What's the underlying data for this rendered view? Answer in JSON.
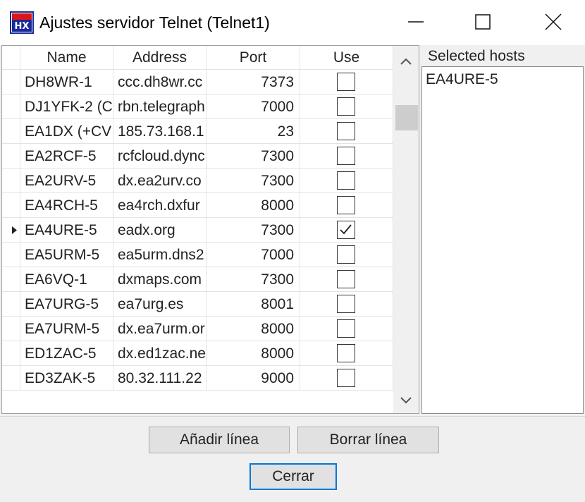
{
  "window": {
    "title": "Ajustes servidor Telnet (Telnet1)",
    "icon": "hx-app-icon",
    "controls": [
      "minimize-icon",
      "maximize-icon",
      "close-icon"
    ]
  },
  "grid": {
    "columns": [
      "Name",
      "Address",
      "Port",
      "Use"
    ],
    "current_row_marker": "row-indicator-icon",
    "rows": [
      {
        "name": "DH8WR-1",
        "address": "ccc.dh8wr.cc",
        "port": "7373",
        "use": false,
        "current": false
      },
      {
        "name": "DJ1YFK-2 (C",
        "address": "rbn.telegraph",
        "port": "7000",
        "use": false,
        "current": false
      },
      {
        "name": "EA1DX (+CV",
        "address": "185.73.168.1",
        "port": "23",
        "use": false,
        "current": false
      },
      {
        "name": "EA2RCF-5",
        "address": "rcfcloud.dync",
        "port": "7300",
        "use": false,
        "current": false
      },
      {
        "name": "EA2URV-5",
        "address": "dx.ea2urv.co",
        "port": "7300",
        "use": false,
        "current": false
      },
      {
        "name": "EA4RCH-5",
        "address": "ea4rch.dxfur",
        "port": "8000",
        "use": false,
        "current": false
      },
      {
        "name": "EA4URE-5",
        "address": "eadx.org",
        "port": "7300",
        "use": true,
        "current": true
      },
      {
        "name": "EA5URM-5",
        "address": "ea5urm.dns2",
        "port": "7000",
        "use": false,
        "current": false
      },
      {
        "name": "EA6VQ-1",
        "address": "dxmaps.com",
        "port": "7300",
        "use": false,
        "current": false
      },
      {
        "name": "EA7URG-5",
        "address": "ea7urg.es",
        "port": "8001",
        "use": false,
        "current": false
      },
      {
        "name": "EA7URM-5",
        "address": "dx.ea7urm.or",
        "port": "8000",
        "use": false,
        "current": false
      },
      {
        "name": "ED1ZAC-5",
        "address": "dx.ed1zac.ne",
        "port": "8000",
        "use": false,
        "current": false
      },
      {
        "name": "ED3ZAK-5",
        "address": "80.32.111.22",
        "port": "9000",
        "use": false,
        "current": false
      }
    ]
  },
  "selected_hosts": {
    "label": "Selected hosts",
    "items": [
      "EA4URE-5"
    ]
  },
  "buttons": {
    "add_line": "Añadir línea",
    "delete_line": "Borrar línea",
    "close": "Cerrar"
  },
  "colors": {
    "focus_border": "#0078d7",
    "dialog_background": "#f0f0f0"
  }
}
